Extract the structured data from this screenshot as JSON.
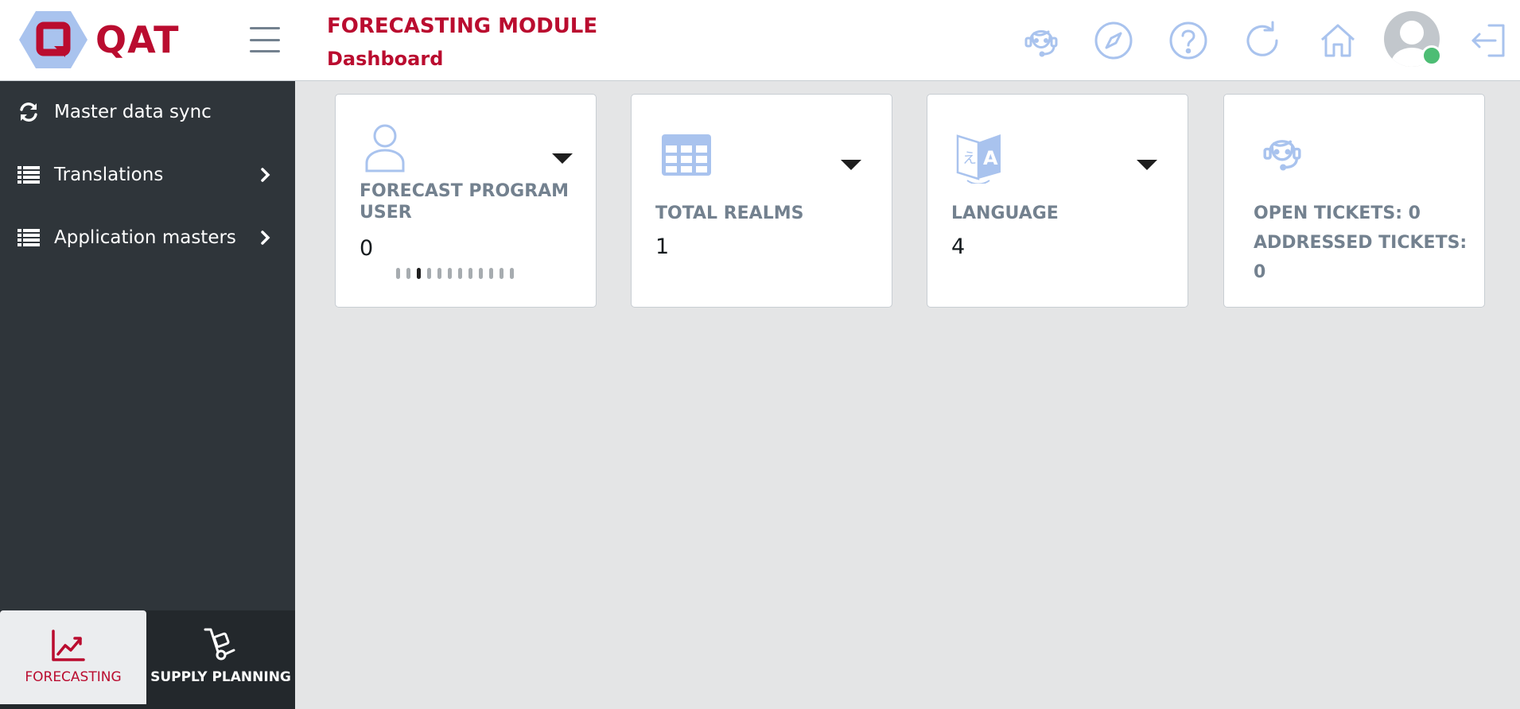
{
  "app": {
    "logo_text": "QAT",
    "module_title": "FORECASTING MODULE",
    "page_title": "Dashboard"
  },
  "header_icons": [
    "headset-icon",
    "compass-icon",
    "help-icon",
    "refresh-icon",
    "home-icon",
    "avatar",
    "logout-icon"
  ],
  "sidebar": {
    "items": [
      {
        "label": "Master data sync",
        "icon": "sync-icon",
        "has_children": false
      },
      {
        "label": "Translations",
        "icon": "list-icon",
        "has_children": true
      },
      {
        "label": "Application masters",
        "icon": "list-icon",
        "has_children": true
      }
    ],
    "bottom_tabs": [
      {
        "label": "FORECASTING",
        "icon": "trend-chart-icon",
        "active": true
      },
      {
        "label": "SUPPLY PLANNING",
        "icon": "hand-truck-icon",
        "active": false
      }
    ]
  },
  "cards": [
    {
      "label": "FORECAST PROGRAM USER",
      "value": "0",
      "icon": "user-icon",
      "has_dropdown": true,
      "carousel_dots": 12,
      "active_dot": 2
    },
    {
      "label": "TOTAL REALMS",
      "value": "1",
      "icon": "grid-icon",
      "has_dropdown": true
    },
    {
      "label": "LANGUAGE",
      "value": "4",
      "icon": "translate-icon",
      "has_dropdown": true
    },
    {
      "label": "OPEN TICKETS: 0",
      "label2": "ADDRESSED TICKETS:",
      "value": "0",
      "icon": "headset-icon",
      "has_dropdown": false
    }
  ],
  "colors": {
    "brand": "#ba0c2f",
    "sidebar_bg": "#2f353a",
    "icon_blue": "#a9c3ee",
    "page_bg": "#e4e5e6",
    "status_online": "#4dbd74"
  }
}
